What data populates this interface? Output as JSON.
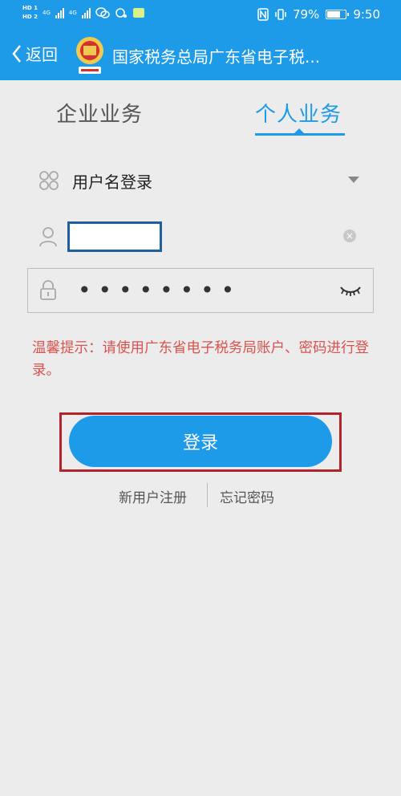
{
  "status_bar": {
    "battery_text": "79%",
    "time": "9:50",
    "sim1_label": "HD 1",
    "sim2_label": "HD 2",
    "network_1": "4G",
    "network_2": "4G",
    "battery_level": 0.79
  },
  "nav": {
    "back_label": "返回",
    "title": "国家税务总局广东省电子税..."
  },
  "tabs": [
    {
      "label": "企业业务",
      "active": false
    },
    {
      "label": "个人业务",
      "active": true
    }
  ],
  "login_type": {
    "label": "用户名登录"
  },
  "username": {
    "value": ""
  },
  "password": {
    "masked": "••••••••"
  },
  "hint": {
    "text": "温馨提示：请使用广东省电子税务局账户、密码进行登录。"
  },
  "login_button": {
    "label": "登录"
  },
  "links": {
    "register": "新用户注册",
    "forgot": "忘记密码"
  },
  "colors": {
    "primary": "#1e9be8",
    "hint": "#d9534f",
    "highlight": "#b0242a",
    "background": "#ececec"
  },
  "icons": {
    "back": "chevron-left-icon",
    "login_type": "grid-icon",
    "user": "user-icon",
    "lock": "lock-icon",
    "clear": "close-circle-icon",
    "eye": "eye-closed-icon"
  }
}
